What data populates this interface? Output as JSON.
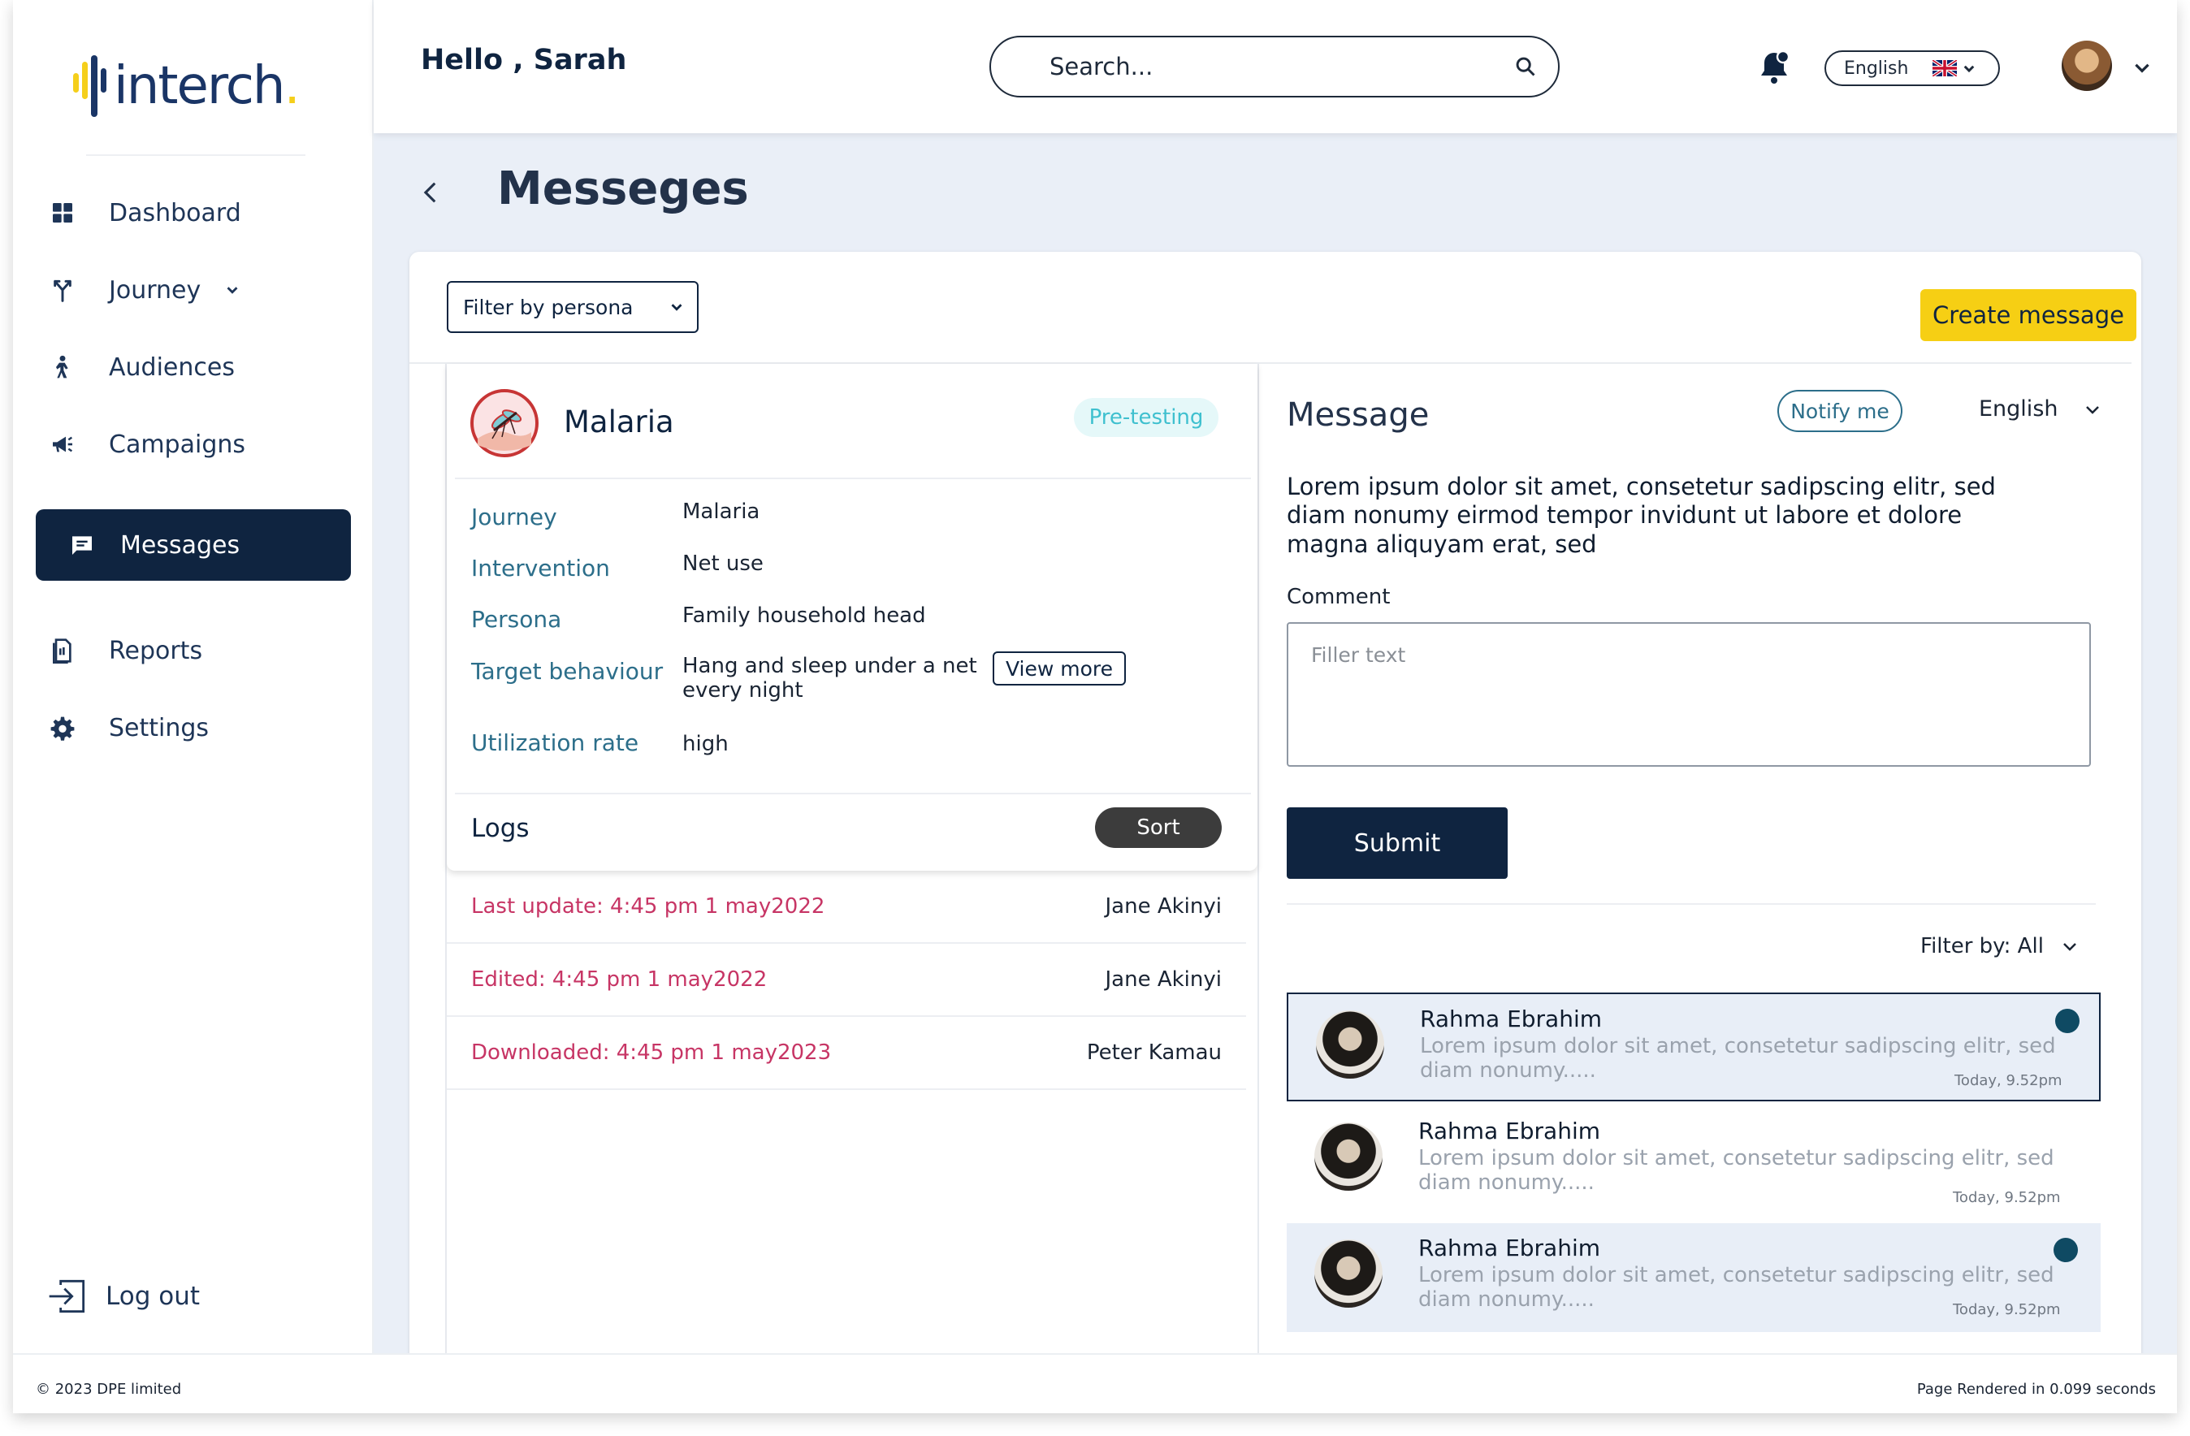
{
  "brand": {
    "logo_text": "interch",
    "logo_dot": "."
  },
  "greeting": "Hello , Sarah",
  "search": {
    "placeholder": "Search..."
  },
  "language": {
    "selected": "English",
    "flag": "uk-flag-icon"
  },
  "sidebar": {
    "items": [
      {
        "label": "Dashboard",
        "icon": "grid-icon"
      },
      {
        "label": "Journey",
        "icon": "fork-icon",
        "has_dropdown": true
      },
      {
        "label": "Audiences",
        "icon": "person-icon"
      },
      {
        "label": "Campaigns",
        "icon": "megaphone-icon"
      },
      {
        "label": "Messages",
        "icon": "message-icon",
        "active": true
      },
      {
        "label": "Reports",
        "icon": "report-icon"
      },
      {
        "label": "Settings",
        "icon": "gear-icon"
      }
    ],
    "logout": "Log out"
  },
  "page": {
    "title": "Messeges"
  },
  "toolbar": {
    "filter_persona": "Filter by persona",
    "create_label": "Create message"
  },
  "persona": {
    "title": "Malaria",
    "status": "Pre-testing",
    "fields": [
      {
        "label": "Journey",
        "value": "Malaria"
      },
      {
        "label": "Intervention",
        "value": "Net use"
      },
      {
        "label": "Persona",
        "value": "Family household head"
      },
      {
        "label": "Target behaviour",
        "value": "Hang and sleep under a net every night"
      },
      {
        "label": "Utilization rate",
        "value": "high"
      }
    ],
    "view_more": "View more"
  },
  "logs": {
    "title": "Logs",
    "sort_label": "Sort",
    "rows": [
      {
        "text": "Last update: 4:45 pm 1 may2022",
        "user": "Jane Akinyi"
      },
      {
        "text": "Edited: 4:45 pm 1 may2022",
        "user": "Jane Akinyi"
      },
      {
        "text": "Downloaded: 4:45 pm 1 may2023",
        "user": "Peter Kamau"
      }
    ]
  },
  "message": {
    "title": "Message",
    "notify_label": "Notify me",
    "language": "English",
    "body": "Lorem ipsum dolor sit amet, consetetur sadipscing elitr, sed diam nonumy eirmod tempor invidunt ut labore et dolore magna aliquyam erat, sed",
    "comment_label": "Comment",
    "comment_placeholder": "Filler text",
    "submit_label": "Submit",
    "filter_label": "Filter by: All"
  },
  "conversations": [
    {
      "name": "Rahma Ebrahim",
      "text": "Lorem ipsum dolor sit amet, consetetur sadipscing elitr, sed diam nonumy.....",
      "time": "Today, 9.52pm",
      "unread": true
    },
    {
      "name": "Rahma Ebrahim",
      "text": "Lorem ipsum dolor sit amet, consetetur sadipscing elitr, sed diam nonumy.....",
      "time": "Today, 9.52pm",
      "unread": false
    },
    {
      "name": "Rahma Ebrahim",
      "text": "Lorem ipsum dolor sit amet, consetetur sadipscing elitr, sed diam nonumy.....",
      "time": "Today, 9.52pm",
      "unread": true
    }
  ],
  "footer": {
    "copyright": "© 2023 DPE limited",
    "render_info": "Page Rendered in 0.099 seconds"
  },
  "colors": {
    "navy": "#0f2440",
    "accent_yellow": "#f6cf14",
    "log_red": "#c73565",
    "teal": "#3fc0cf",
    "background": "#eaeff7"
  }
}
